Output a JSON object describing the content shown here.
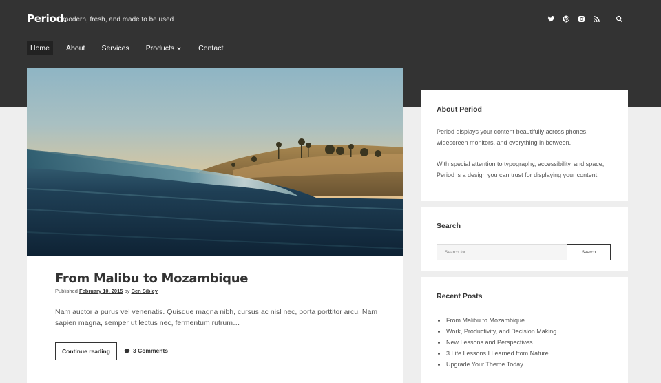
{
  "site": {
    "title": "Period.",
    "tagline": "modern, fresh, and made to be used"
  },
  "social": [
    "twitter-icon",
    "pinterest-icon",
    "instagram-icon",
    "rss-icon",
    "search-icon"
  ],
  "nav": {
    "home": "Home",
    "about": "About",
    "services": "Services",
    "products": "Products",
    "contact": "Contact"
  },
  "post": {
    "title": "From Malibu to Mozambique",
    "published_label": "Published",
    "date": "February 10, 2015",
    "by_label": "by",
    "author": "Ben Sibley",
    "excerpt": "Nam auctor a purus vel venenatis. Quisque magna nibh, cursus ac nisl nec, porta porttitor arcu. Nam sapien magna, semper ut lectus nec, fermentum rutrum…",
    "continue_label": "Continue reading",
    "comments_label": "3 Comments"
  },
  "about_widget": {
    "title": "About Period",
    "paragraph1": "Period displays your content beautifully across phones, widescreen monitors, and everything in between.",
    "paragraph2": "With special attention to typography, accessibility, and space, Period is a design you can trust for displaying your content."
  },
  "search_widget": {
    "title": "Search",
    "placeholder": "Search for...",
    "button_label": "Search"
  },
  "recent_widget": {
    "title": "Recent Posts",
    "items": [
      "From Malibu to Mozambique",
      "Work, Productivity, and Decision Making",
      "New Lessons and Perspectives",
      "3 Life Lessons I Learned from Nature",
      "Upgrade Your Theme Today"
    ]
  },
  "colors": {
    "header": "#333333",
    "page": "#eeeeee",
    "card": "#ffffff",
    "text": "#333333"
  }
}
